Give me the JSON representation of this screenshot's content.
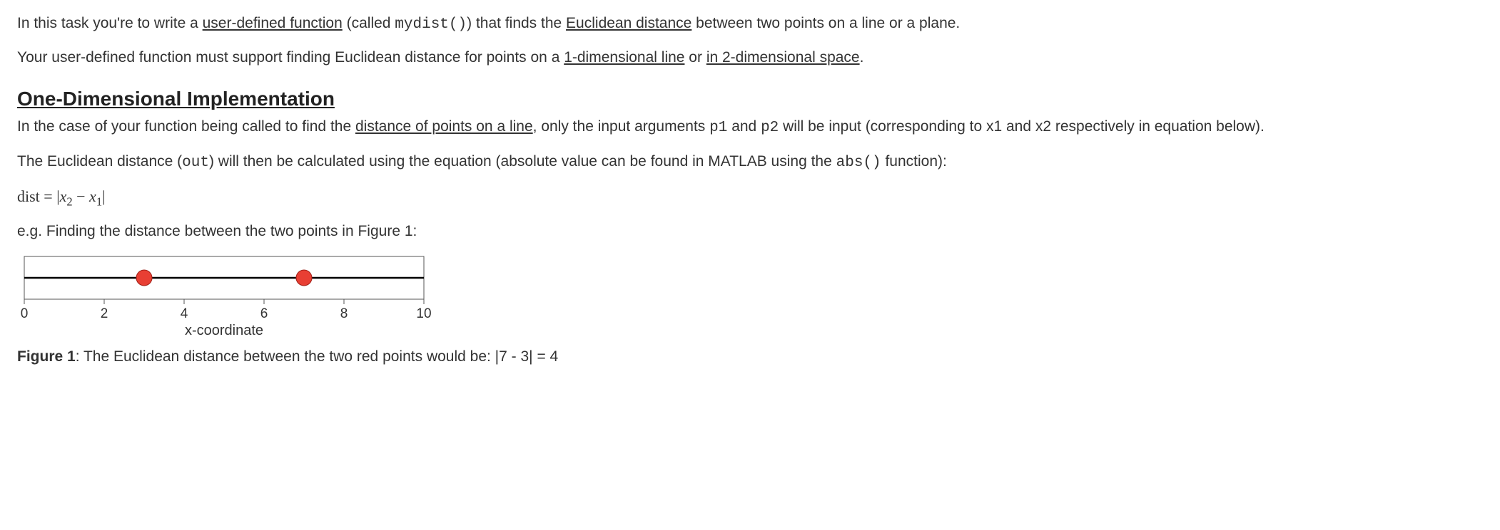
{
  "intro": {
    "p1_a": "In this task you're to write a ",
    "p1_u1": "user-defined function",
    "p1_b": " (called ",
    "p1_code": "mydist()",
    "p1_c": ") that finds the ",
    "p1_u2": "Euclidean distance",
    "p1_d": " between two points on a line or a plane.",
    "p2_a": "Your user-defined function must support finding Euclidean distance for points on a ",
    "p2_u1": "1-dimensional line",
    "p2_b": " or ",
    "p2_u2": "in 2-dimensional space",
    "p2_c": "."
  },
  "section1": {
    "heading": "One-Dimensional Implementation",
    "p1_a": "In the case of your function being called to find the ",
    "p1_u1": "distance of points on a line",
    "p1_b": ", only the input arguments ",
    "p1_code1": "p1",
    "p1_c": " and ",
    "p1_code2": "p2",
    "p1_d": " will be input (corresponding to x1 and x2 respectively in equation below).",
    "p2_a": "The Euclidean distance (",
    "p2_code1": "out",
    "p2_b": ") will then be calculated using the equation (absolute value can be found in MATLAB using the ",
    "p2_code2": "abs()",
    "p2_c": " function):",
    "formula_prefix": "dist = ",
    "formula_abs_open": "|",
    "formula_x2": "x",
    "formula_sub2": "2",
    "formula_minus": " − ",
    "formula_x1": "x",
    "formula_sub1": "1",
    "formula_abs_close": "|",
    "example_intro": "e.g. Finding the distance between the two points in Figure 1:"
  },
  "figure1": {
    "xlabel": "x-coordinate",
    "caption_bold": "Figure 1",
    "caption_rest": ": The Euclidean distance between the two red points would be: |7 - 3| = 4"
  },
  "chart_data": {
    "type": "scatter",
    "title": "",
    "xlabel": "x-coordinate",
    "ylabel": "",
    "x": [
      3,
      7
    ],
    "y": [
      0,
      0
    ],
    "xlim": [
      0,
      10
    ],
    "xticks": [
      0,
      2,
      4,
      6,
      8,
      10
    ],
    "marker_color": "#e83f33",
    "line_color": "#000000"
  }
}
